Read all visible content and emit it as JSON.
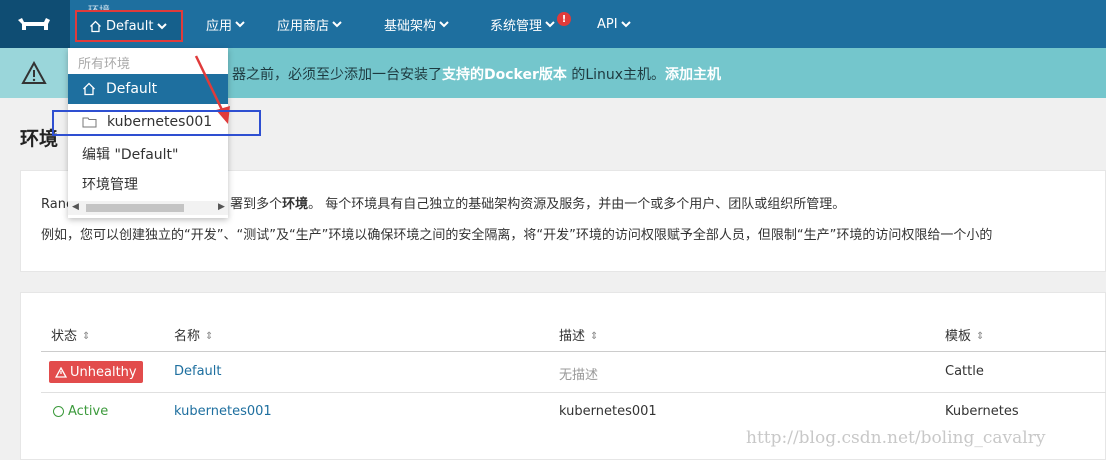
{
  "nav": {
    "env_caption": "环境",
    "env_current": "Default",
    "items": [
      {
        "label": "应用"
      },
      {
        "label": "应用商店"
      },
      {
        "label": "基础架构"
      },
      {
        "label": "系统管理"
      },
      {
        "label": "API"
      }
    ],
    "alert_mark": "!"
  },
  "banner": {
    "text_before": "器之前，必须至少添加一台安装了",
    "link_docker": "支持的Docker版本",
    "text_middle": " 的Linux主机。",
    "link_add": "添加主机"
  },
  "page": {
    "title": "环境"
  },
  "info": {
    "line1_prefix": "Ranc",
    "line1_middle": "署到多个",
    "line1_bold": "环境",
    "line1_rest": "。 每个环境具有自己独立的基础架构资源及服务，并由一个或多个用户、团队或组织所管理。",
    "line2": "例如，您可以创建独立的“开发”、“测试”及“生产”环境以确保环境之间的安全隔离，将“开发”环境的访问权限赋予全部人员，但限制“生产”环境的访问权限给一个小的"
  },
  "dropdown": {
    "header": "所有环境",
    "items": [
      {
        "label": "Default",
        "icon": "home-icon"
      },
      {
        "label": "kubernetes001",
        "icon": "folder-icon"
      }
    ],
    "edit_label": "编辑 \"Default\"",
    "manage_label": "环境管理"
  },
  "table": {
    "columns": [
      "状态",
      "名称",
      "描述",
      "模板"
    ],
    "rows": [
      {
        "status": "Unhealthy",
        "name": "Default",
        "description": "无描述",
        "template": "Cattle"
      },
      {
        "status": "Active",
        "name": "kubernetes001",
        "description": "kubernetes001",
        "template": "Kubernetes"
      }
    ]
  },
  "watermark": "http://blog.csdn.net/boling_cavalry",
  "colors": {
    "nav_bg": "#1e6f9f",
    "banner_bg": "#74c6cc",
    "unhealthy": "#e24c4c",
    "active": "#3c9a3c",
    "highlight_red": "#e03b3b",
    "highlight_blue": "#2e4fd1"
  }
}
